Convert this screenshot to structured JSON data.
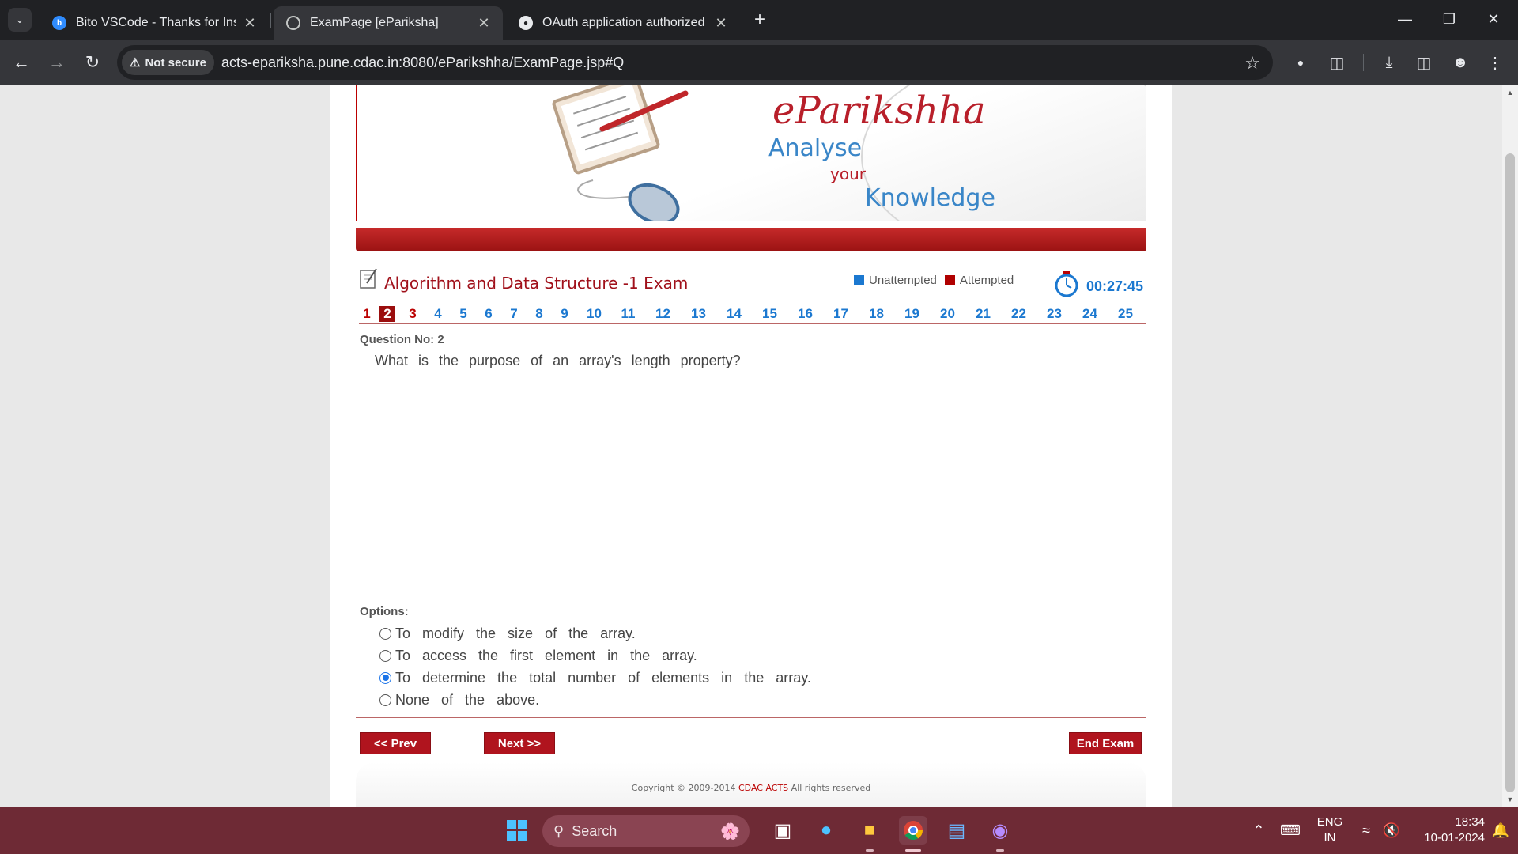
{
  "browser": {
    "tabs": [
      {
        "title": "Bito VSCode - Thanks for Install",
        "icon": "bito-icon",
        "active": false
      },
      {
        "title": "ExamPage [ePariksha]",
        "icon": "globe-icon",
        "active": true
      },
      {
        "title": "OAuth application authorized",
        "icon": "github-icon",
        "active": false
      }
    ],
    "security_chip": "Not secure",
    "url": "acts-epariksha.pune.cdac.in:8080/eParikshha/ExamPage.jsp#Q"
  },
  "banner": {
    "brand": "eParikshha",
    "line1": "Analyse",
    "line2": "your",
    "line3": "Knowledge"
  },
  "exam": {
    "title": "Algorithm and Data Structure -1 Exam",
    "legend_unattempted": "Unattempted",
    "legend_attempted": "Attempted",
    "timer": "00:27:45",
    "colors": {
      "unattempted": "#1b78d0",
      "attempted": "#b00000",
      "current": "#9b0e0e"
    }
  },
  "questions": {
    "numbers": [
      "1",
      "2",
      "3",
      "4",
      "5",
      "6",
      "7",
      "8",
      "9",
      "10",
      "11",
      "12",
      "13",
      "14",
      "15",
      "16",
      "17",
      "18",
      "19",
      "20",
      "21",
      "22",
      "23",
      "24",
      "25"
    ],
    "attempted": [
      1,
      2,
      3
    ],
    "current": 2
  },
  "question": {
    "label": "Question No: 2",
    "text": "What is the purpose of an array's length property?"
  },
  "options": {
    "label": "Options:",
    "items": [
      "To modify the size of the array.",
      "To access the first element in the array.",
      "To determine the total number of elements in the array.",
      "None of the above."
    ],
    "selected": 2
  },
  "buttons": {
    "prev": "<< Prev",
    "next": "Next >>",
    "end": "End Exam"
  },
  "footer": {
    "prefix": "Copyright © 2009-2014",
    "brand": "CDAC ACTS",
    "suffix": "All rights reserved"
  },
  "taskbar": {
    "search_placeholder": "Search",
    "lang_line1": "ENG",
    "lang_line2": "IN",
    "time": "18:34",
    "date": "10-01-2024"
  }
}
